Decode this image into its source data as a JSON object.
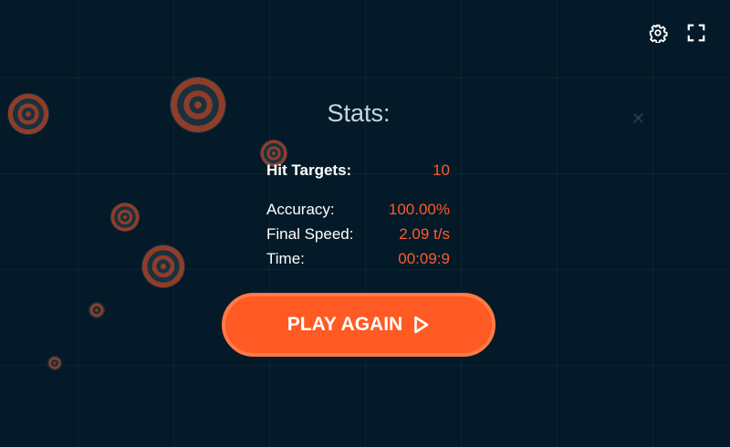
{
  "stats": {
    "title": "Stats:",
    "hit_targets_label": "Hit Targets:",
    "hit_targets_value": "10",
    "accuracy_label": "Accuracy:",
    "accuracy_value": "100.00%",
    "final_speed_label": "Final Speed:",
    "final_speed_value": "2.09 t/s",
    "time_label": "Time:",
    "time_value": "00:09:9"
  },
  "play_again_label": "PLAY AGAIN",
  "icons": {
    "settings": "gear-icon",
    "fullscreen": "fullscreen-icon",
    "play": "play-triangle-icon",
    "target": "target-icon",
    "crosshair": "close-icon"
  },
  "colors": {
    "background": "#041a28",
    "accent": "#ff5a24",
    "value_text": "#ff5a2a",
    "title_text": "#c8d6e2"
  }
}
